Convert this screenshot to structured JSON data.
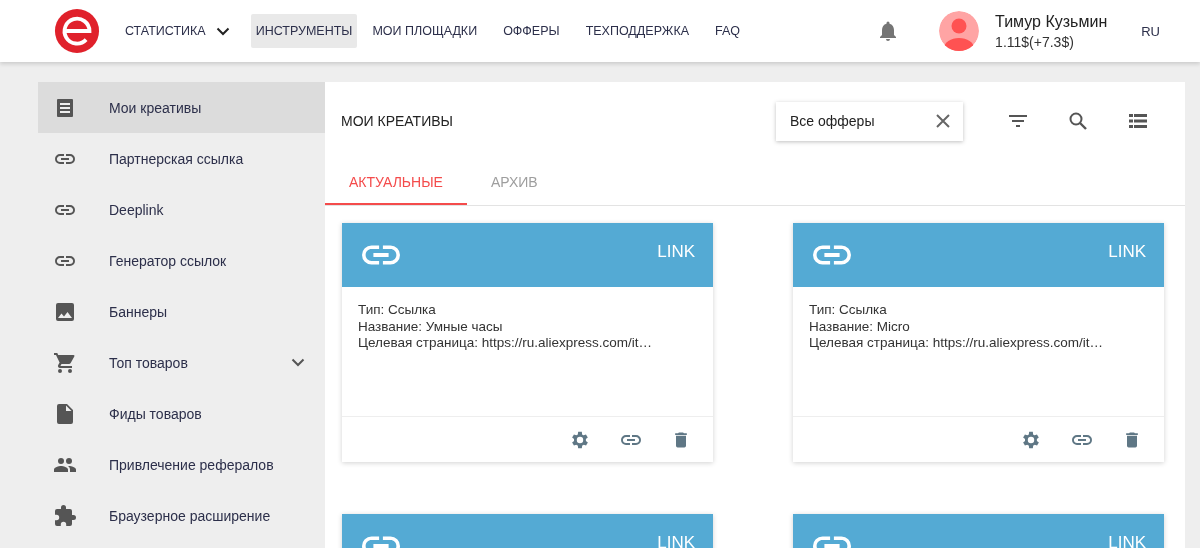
{
  "header": {
    "nav": [
      {
        "label": "СТАТИСТИКА",
        "selected": false,
        "dropdown": true
      },
      {
        "label": "ИНСТРУМЕНТЫ",
        "selected": true,
        "dropdown": false
      },
      {
        "label": "МОИ ПЛОЩАДКИ",
        "selected": false,
        "dropdown": false
      },
      {
        "label": "ОФФЕРЫ",
        "selected": false,
        "dropdown": false
      },
      {
        "label": "ТЕХПОДДЕРЖКА",
        "selected": false,
        "dropdown": false
      },
      {
        "label": "FAQ",
        "selected": false,
        "dropdown": false
      }
    ],
    "user": {
      "name": "Тимур Кузьмин",
      "balance": "1.11$(+7.3$)"
    },
    "language": "RU"
  },
  "sidebar": {
    "items": [
      {
        "label": "Мои креативы",
        "kind": "list",
        "selected": true,
        "submenu": false
      },
      {
        "label": "Партнерская ссылка",
        "kind": "link",
        "selected": false,
        "submenu": false
      },
      {
        "label": "Deeplink",
        "kind": "link",
        "selected": false,
        "submenu": false
      },
      {
        "label": "Генератор ссылок",
        "kind": "link",
        "selected": false,
        "submenu": false
      },
      {
        "label": "Баннеры",
        "kind": "image",
        "selected": false,
        "submenu": false
      },
      {
        "label": "Топ товаров",
        "kind": "cart",
        "selected": false,
        "submenu": true
      },
      {
        "label": "Фиды товаров",
        "kind": "file",
        "selected": false,
        "submenu": false
      },
      {
        "label": "Привлечение рефералов",
        "kind": "people",
        "selected": false,
        "submenu": false
      },
      {
        "label": "Браузерное расширение",
        "kind": "puzzle",
        "selected": false,
        "submenu": false
      }
    ]
  },
  "content": {
    "title": "МОИ КРЕАТИВЫ",
    "offer_filter": {
      "value": "Все офферы"
    },
    "tabs": [
      {
        "label": "АКТУАЛЬНЫЕ",
        "selected": true
      },
      {
        "label": "АРХИВ",
        "selected": false
      }
    ],
    "cards": [
      {
        "badge": "LINK",
        "lines": [
          "Тип: Ссылка",
          "Название: Умные часы",
          "Целевая страница: https://ru.aliexpress.com/it…"
        ]
      },
      {
        "badge": "LINK",
        "lines": [
          "Тип: Ссылка",
          "Название: Micro",
          "Целевая страница: https://ru.aliexpress.com/it…"
        ]
      },
      {
        "badge": "LINK"
      },
      {
        "badge": "LINK"
      }
    ]
  }
}
